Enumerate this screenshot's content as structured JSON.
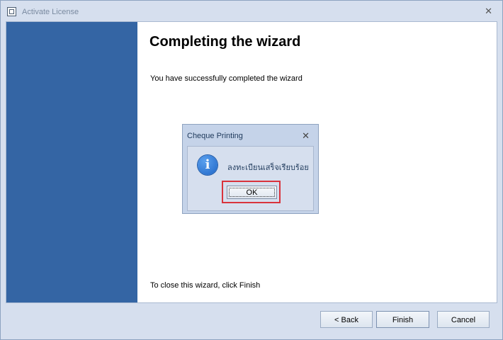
{
  "window": {
    "title": "Activate License",
    "close_glyph": "✕",
    "icon": "app-window-icon"
  },
  "wizard": {
    "heading": "Completing the wizard",
    "subtext": "You have successfully completed the wizard",
    "footer_text": "To close this wizard, click Finish"
  },
  "dialog": {
    "title": "Cheque Printing",
    "close_glyph": "✕",
    "icon": "info-icon",
    "icon_glyph": "i",
    "message": "ลงทะเบียนเสร็จเรียบร้อย",
    "ok_label": "OK"
  },
  "buttons": {
    "back_label": "< Back",
    "finish_label": "Finish",
    "cancel_label": "Cancel"
  },
  "colors": {
    "sidebar": "#3465a4",
    "highlight": "#d9333c",
    "chrome": "#d6dfee"
  }
}
